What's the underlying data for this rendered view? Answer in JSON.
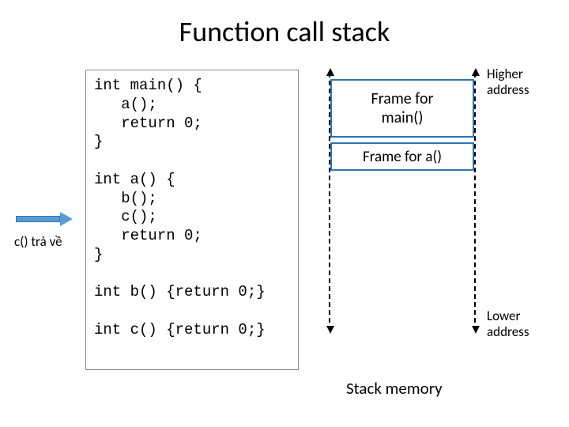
{
  "title": "Function call stack",
  "arrow_label": "c() trả về",
  "code": "int main() {\n   a();\n   return 0;\n}\n\nint a() {\n   b();\n   c();\n   return 0;\n}\n\nint b() {return 0;}\n\nint c() {return 0;}",
  "frames": {
    "main": "Frame for\nmain()",
    "a": "Frame for a()"
  },
  "labels": {
    "higher": "Higher\naddress",
    "lower": "Lower\naddress",
    "stack_caption": "Stack memory"
  }
}
